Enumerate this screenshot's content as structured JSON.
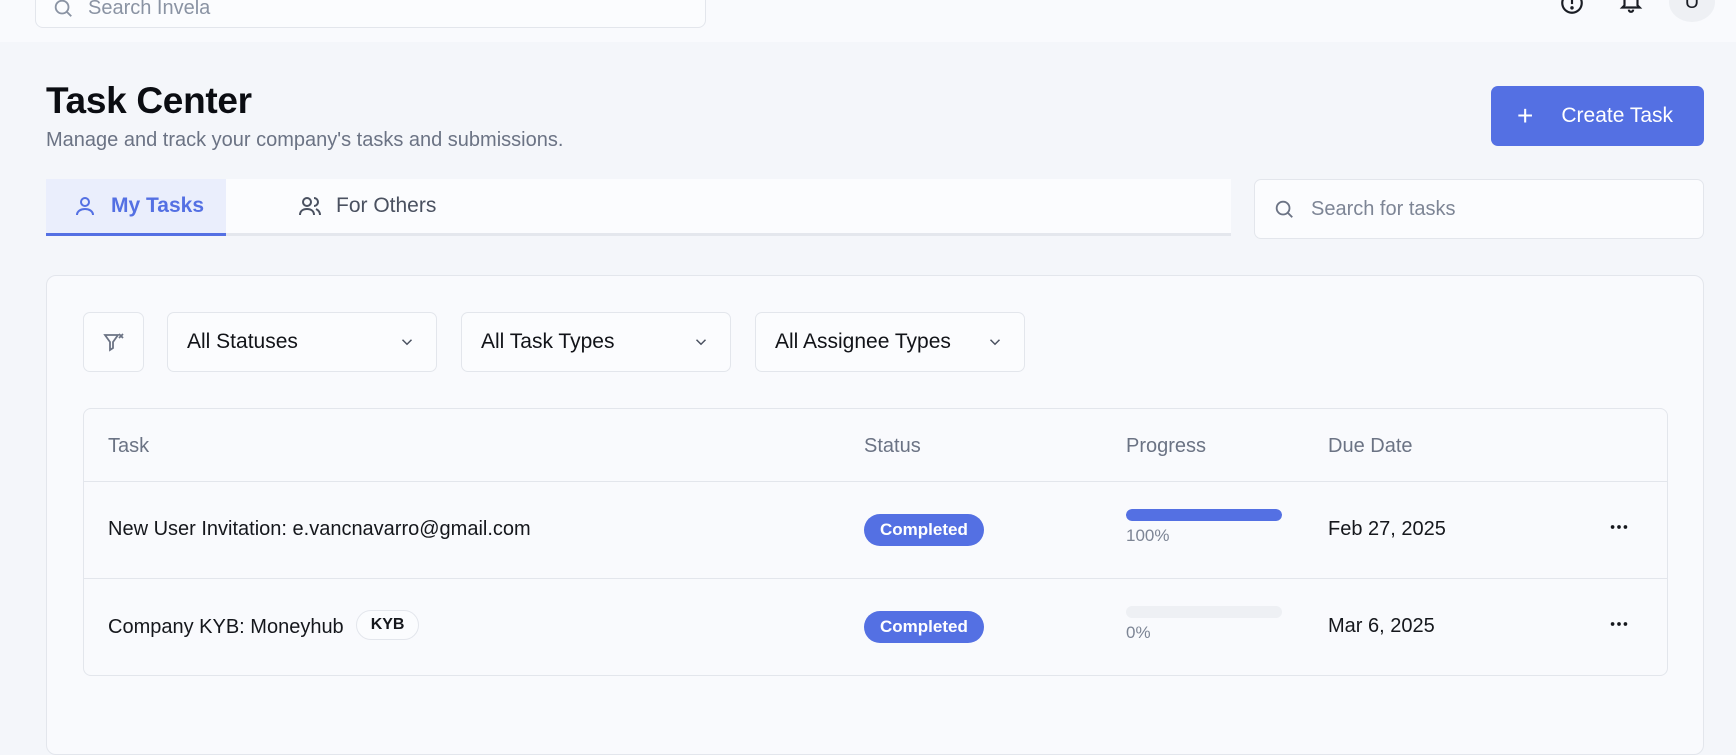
{
  "topbar": {
    "search_placeholder": "Search Invela",
    "avatar_initial": "U"
  },
  "header": {
    "title": "Task Center",
    "subtitle": "Manage and track your company's tasks and submissions.",
    "create_label": "Create Task"
  },
  "tabs": [
    {
      "label": "My Tasks",
      "active": true
    },
    {
      "label": "For Others",
      "active": false
    }
  ],
  "task_search": {
    "placeholder": "Search for tasks"
  },
  "filters": {
    "status": "All Statuses",
    "task_type": "All Task Types",
    "assignee_type": "All Assignee Types"
  },
  "table": {
    "columns": [
      "Task",
      "Status",
      "Progress",
      "Due Date"
    ],
    "rows": [
      {
        "task": "New User Invitation: e.vancnavarro@gmail.com",
        "tag": "",
        "status": "Completed",
        "progress": 100,
        "progress_label": "100%",
        "due": "Feb 27, 2025"
      },
      {
        "task": "Company KYB: Moneyhub",
        "tag": "KYB",
        "status": "Completed",
        "progress": 0,
        "progress_label": "0%",
        "due": "Mar 6, 2025"
      }
    ]
  },
  "colors": {
    "accent": "#5470e3",
    "background": "#f4f6fa"
  }
}
